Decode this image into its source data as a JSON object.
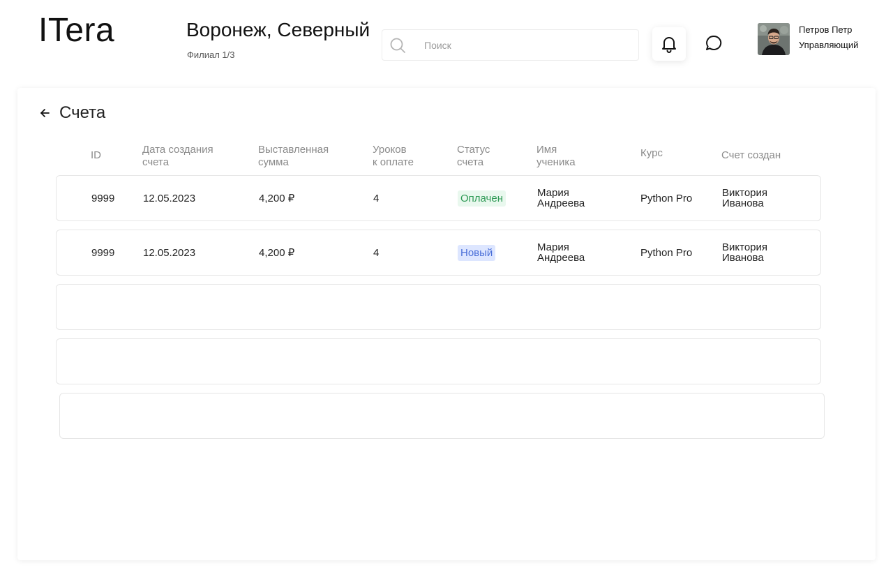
{
  "header": {
    "logo": "ITera",
    "branch_title": "Воронеж, Северный",
    "branch_sub": "Филиал 1/3",
    "search": {
      "placeholder": "Поиск",
      "value": ""
    },
    "user": {
      "name": "Петров Петр",
      "role": "Управляющий"
    }
  },
  "page": {
    "title": "Счета"
  },
  "table": {
    "columns": [
      "ID",
      "Дата создания\nсчета",
      "Выставленная\nсумма",
      "Уроков\nк оплате",
      "Статус\nсчета",
      "Имя\nученика",
      "Курс",
      "Счет создан"
    ],
    "rows": [
      {
        "id": "9999",
        "date": "12.05.2023",
        "amount": "4,200 ₽",
        "lessons": "4",
        "status": "Оплачен",
        "student": "Мария\nАндреева",
        "course": "Python Pro",
        "created_by": "Виктория\nИванова"
      },
      {
        "id": "9999",
        "date": "12.05.2023",
        "amount": "4,200 ₽",
        "lessons": "4",
        "status": "Новый",
        "student": "Мария\nАндреева",
        "course": "Python Pro",
        "created_by": "Виктория\nИванова"
      }
    ]
  },
  "colors": {
    "paid_bg": "#e9f8ee",
    "paid_text": "#2e9a55",
    "new_bg": "#dde6ff",
    "new_text": "#4a6fd8"
  },
  "icons": {
    "search": "search-icon",
    "bell": "bell-icon",
    "chat": "chat-icon",
    "back": "arrow-left-icon"
  }
}
